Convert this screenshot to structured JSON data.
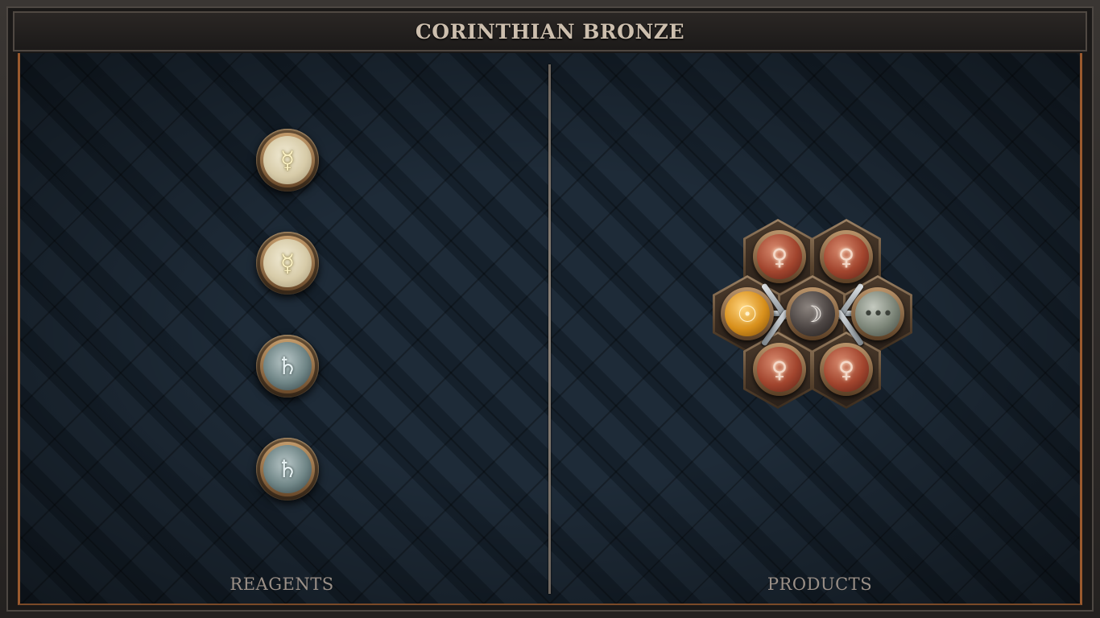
{
  "title": "CORINTHIAN BRONZE",
  "panels": {
    "reagents_label": "REAGENTS",
    "products_label": "PRODUCTS"
  },
  "reagents": [
    {
      "element": "mercury",
      "symbol": "☿"
    },
    {
      "element": "mercury",
      "symbol": "☿"
    },
    {
      "element": "lead",
      "symbol": "♄"
    },
    {
      "element": "lead",
      "symbol": "♄"
    }
  ],
  "product": {
    "center": {
      "element": "silver",
      "symbol": "☽"
    },
    "atoms": [
      {
        "element": "copper",
        "symbol": "♀"
      },
      {
        "element": "copper",
        "symbol": "♀"
      },
      {
        "element": "gold",
        "symbol": "☉"
      },
      {
        "element": "quintessence",
        "symbol": "•••"
      },
      {
        "element": "copper",
        "symbol": "♀"
      },
      {
        "element": "copper",
        "symbol": "♀"
      }
    ]
  },
  "colors": {
    "accent_copper": "#9b5a2e",
    "title_text": "#cdbfae",
    "label_text": "#9b9087",
    "board_bg": "#16212c"
  }
}
